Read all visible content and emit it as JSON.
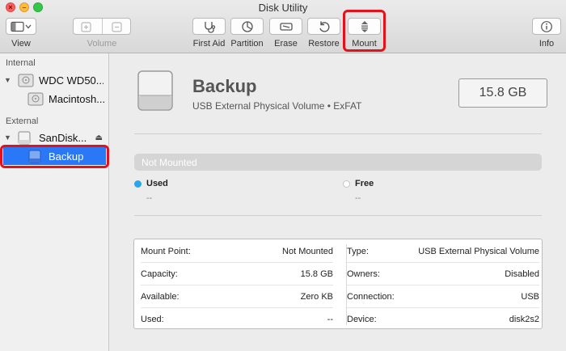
{
  "window": {
    "title": "Disk Utility"
  },
  "toolbar": {
    "view_label": "View",
    "volume_label": "Volume",
    "first_aid_label": "First Aid",
    "partition_label": "Partition",
    "erase_label": "Erase",
    "restore_label": "Restore",
    "mount_label": "Mount",
    "info_label": "Info"
  },
  "sidebar": {
    "internal_header": "Internal",
    "external_header": "External",
    "items": [
      {
        "label": "WDC WD50..."
      },
      {
        "label": "Macintosh..."
      },
      {
        "label": "SanDisk..."
      },
      {
        "label": "Backup"
      }
    ]
  },
  "volume": {
    "name": "Backup",
    "description": "USB External Physical Volume • ExFAT",
    "size": "15.8 GB",
    "bar_status": "Not Mounted"
  },
  "legend": {
    "used_label": "Used",
    "used_value": "--",
    "free_label": "Free",
    "free_value": "--",
    "used_color": "#2aa7e8"
  },
  "info": {
    "left": [
      {
        "key": "Mount Point:",
        "value": "Not Mounted"
      },
      {
        "key": "Capacity:",
        "value": "15.8 GB"
      },
      {
        "key": "Available:",
        "value": "Zero KB"
      },
      {
        "key": "Used:",
        "value": "--"
      }
    ],
    "right": [
      {
        "key": "Type:",
        "value": "USB External Physical Volume"
      },
      {
        "key": "Owners:",
        "value": "Disabled"
      },
      {
        "key": "Connection:",
        "value": "USB"
      },
      {
        "key": "Device:",
        "value": "disk2s2"
      }
    ]
  }
}
